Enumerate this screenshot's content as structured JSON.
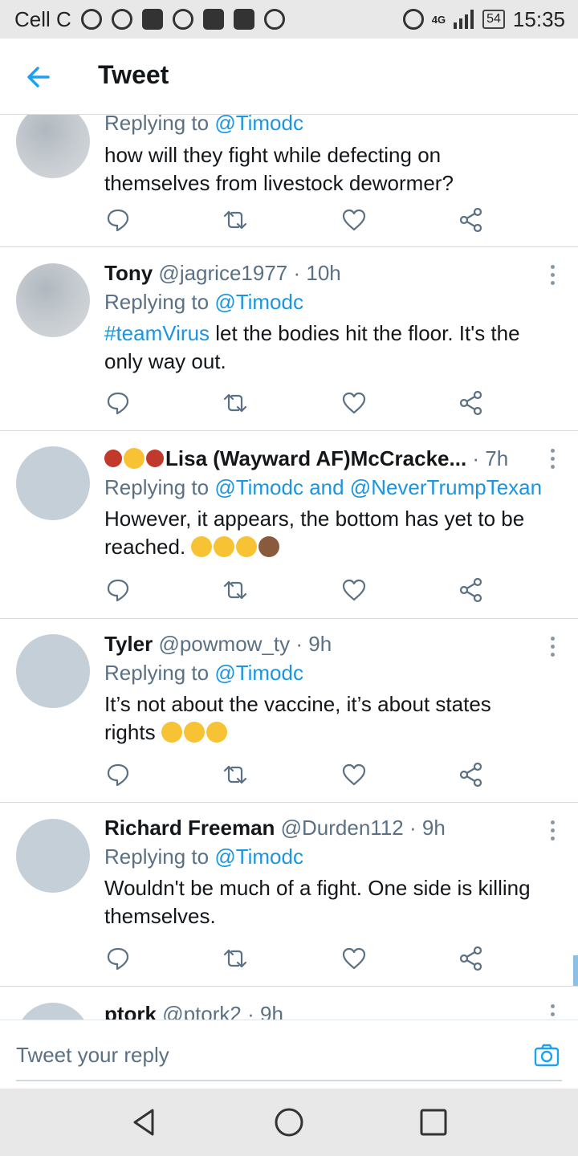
{
  "status_bar": {
    "carrier": "Cell C",
    "network": "4G",
    "battery": "54",
    "time": "15:35"
  },
  "app_bar": {
    "title": "Tweet"
  },
  "tweets": [
    {
      "name": "",
      "handle": "",
      "time": "",
      "replying_prefix": "Replying to ",
      "replying_to": "@Timodc",
      "text": "how will they fight while defecting on themselves from livestock dewormer?"
    },
    {
      "name": "Tony",
      "handle": "@jagrice1977",
      "time": "10h",
      "replying_prefix": "Replying to ",
      "replying_to": "@Timodc",
      "hashtag": "#teamVirus",
      "text": " let the bodies hit the floor. It's the only way out."
    },
    {
      "name": "Lisa (Wayward AF)McCracke...",
      "handle": "",
      "time": "7h",
      "replying_prefix": "Replying to ",
      "replying_to": "@Timodc and @NeverTrumpTexan",
      "text": "However, it appears, the bottom has yet to be reached."
    },
    {
      "name": "Tyler",
      "handle": "@powmow_ty",
      "time": "9h",
      "replying_prefix": "Replying to ",
      "replying_to": "@Timodc",
      "text": "It’s not about the vaccine, it’s about states rights"
    },
    {
      "name": "Richard Freeman",
      "handle": "@Durden112",
      "time": "9h",
      "replying_prefix": "Replying to ",
      "replying_to": "@Timodc",
      "text": "Wouldn't be much of a fight. One side is killing themselves."
    },
    {
      "name": "ptork",
      "handle": "@ptork2",
      "time": "9h"
    }
  ],
  "separator": " · ",
  "composer": {
    "placeholder": "Tweet your reply"
  },
  "icons": {
    "back": "arrow-left-icon",
    "reply": "reply-icon",
    "retweet": "retweet-icon",
    "like": "heart-icon",
    "share": "share-icon",
    "more": "more-vertical-icon",
    "camera": "camera-icon"
  },
  "colors": {
    "accent": "#1da1f2",
    "mention": "#1b95e0",
    "secondary_text": "#5b7083"
  }
}
